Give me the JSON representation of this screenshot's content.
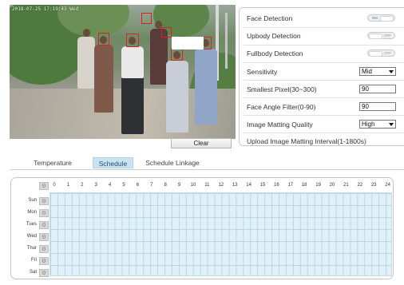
{
  "video": {
    "osd": "2018-07-25 17:19:43 Wed"
  },
  "clear_label": "Clear",
  "panel": {
    "face_detection": {
      "label": "Face Detection",
      "state": "ON"
    },
    "upbody_detection": {
      "label": "Upbody Detection",
      "state": "OFF"
    },
    "fullbody_detection": {
      "label": "Fullbody Detection",
      "state": "OFF"
    },
    "sensitivity": {
      "label": "Sensitivity",
      "value": "Mid"
    },
    "smallest_pixel": {
      "label": "Smallest Pixel(30~300)",
      "value": "90"
    },
    "face_angle": {
      "label": "Face Angle Filter(0-90)",
      "value": "90"
    },
    "matting_quality": {
      "label": "Image Matting Quality",
      "value": "High"
    },
    "upload_interval": {
      "label": "Upload Image Matting Interval(1-1800s)"
    }
  },
  "tabs": [
    "Temperature",
    "Schedule",
    "Schedule Linkage"
  ],
  "active_tab": "Schedule",
  "schedule": {
    "hours": [
      "0",
      "1",
      "2",
      "3",
      "4",
      "5",
      "6",
      "7",
      "8",
      "9",
      "10",
      "11",
      "12",
      "13",
      "14",
      "15",
      "16",
      "17",
      "18",
      "19",
      "20",
      "21",
      "22",
      "23",
      "24"
    ],
    "days": [
      "Sun",
      "Mon",
      "Tues",
      "Wed",
      "Thur",
      "Fri",
      "Sat"
    ]
  },
  "colors": {
    "accent": "#c9e3f3",
    "grid": "#dff0f8",
    "face_box": "#e02020"
  }
}
